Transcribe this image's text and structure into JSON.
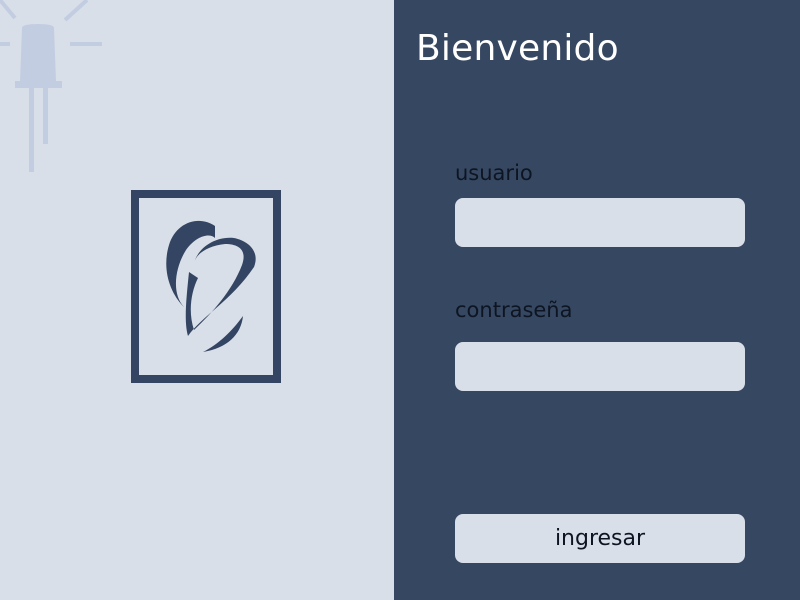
{
  "login": {
    "title": "Bienvenido",
    "username_label": "usuario",
    "username_value": "",
    "password_label": "contraseña",
    "password_value": "",
    "submit_label": "ingresar"
  },
  "icons": {
    "corner": "light-bulb-icon",
    "brand": "letter-c-logo"
  },
  "colors": {
    "panel_light": "#d9dfe8",
    "panel_dark": "#364761",
    "accent": "#334562",
    "decor": "#c3cde2",
    "text_light": "#ffffff",
    "text_dark": "#0e1522"
  }
}
